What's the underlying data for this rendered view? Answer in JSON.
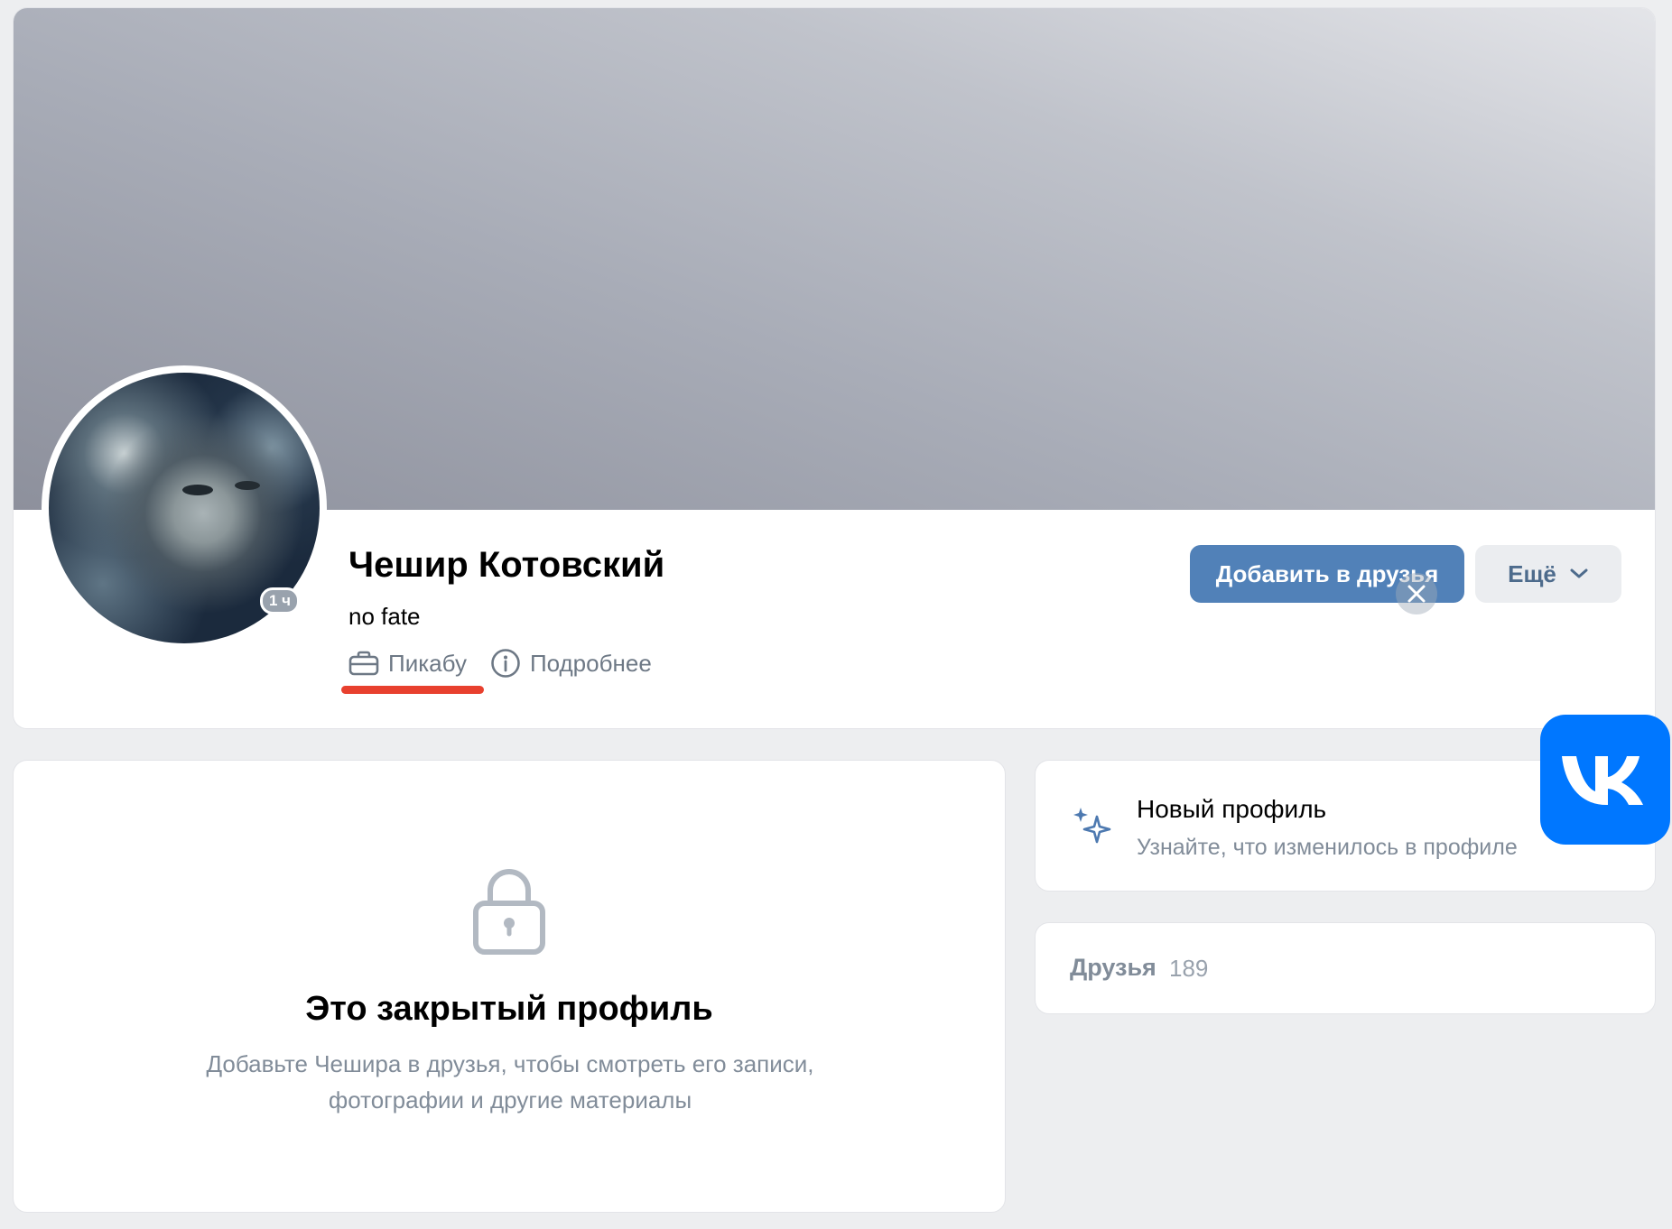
{
  "profile": {
    "name": "Чешир Котовский",
    "status": "no fate",
    "online_badge": "1 ч",
    "work_link": "Пикабу",
    "details_link": "Подробнее"
  },
  "actions": {
    "add_friend": "Добавить в друзья",
    "more": "Ещё"
  },
  "closed_profile": {
    "title": "Это закрытый профиль",
    "text": "Добавьте Чешира в друзья, чтобы смотреть его записи, фотографии и другие материалы"
  },
  "new_profile": {
    "title": "Новый профиль",
    "subtitle": "Узнайте, что изменилось в профиле"
  },
  "friends": {
    "label": "Друзья",
    "count": "189"
  },
  "colors": {
    "accent_button": "#5181b8",
    "secondary_button_text": "#4d6b8c",
    "annotation_underline": "#e8402e",
    "vk_brand": "#0077ff",
    "background": "#edeef0"
  },
  "icons": [
    "briefcase-icon",
    "info-icon",
    "chevron-down-icon",
    "close-icon",
    "lock-icon",
    "sparkle-icon",
    "vk-logo"
  ]
}
